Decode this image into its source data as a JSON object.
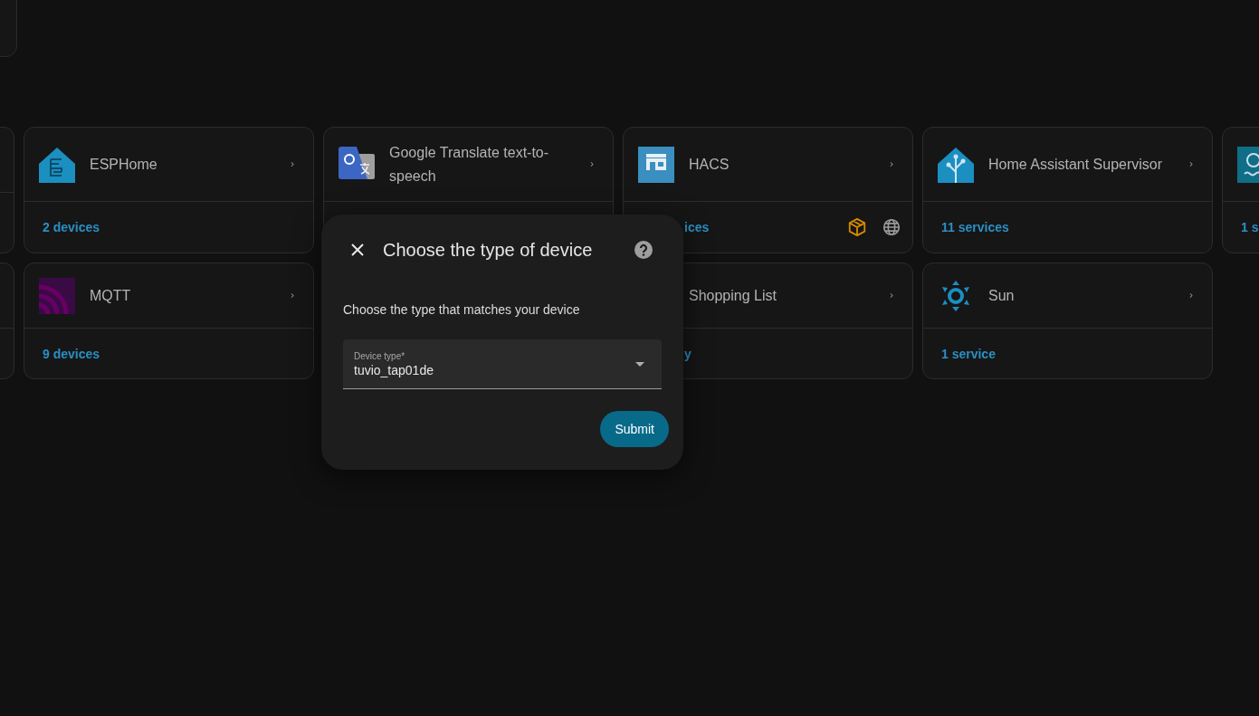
{
  "integration_rows": [
    {
      "cards": [
        {
          "title": "ESPHome",
          "footer": "2 devices"
        },
        {
          "title": "Google Translate text-to-speech"
        },
        {
          "title": "HACS",
          "footer": "ices",
          "footer_clipped": true
        },
        {
          "title": "Home Assistant Supervisor",
          "footer": "11 services"
        },
        {
          "footer": "1 s"
        }
      ]
    },
    {
      "cards": [
        {
          "title": "MQTT",
          "footer": "9 devices"
        },
        {
          "title": "Shopping List",
          "footer": "y",
          "footer_clipped": true
        },
        {
          "title": "Sun",
          "footer": "1 service"
        }
      ]
    }
  ],
  "dialog": {
    "title": "Choose the type of device",
    "description": "Choose the type that matches your device",
    "field": {
      "label": "Device type*",
      "value": "tuvio_tap01de"
    },
    "submit": "Submit"
  }
}
